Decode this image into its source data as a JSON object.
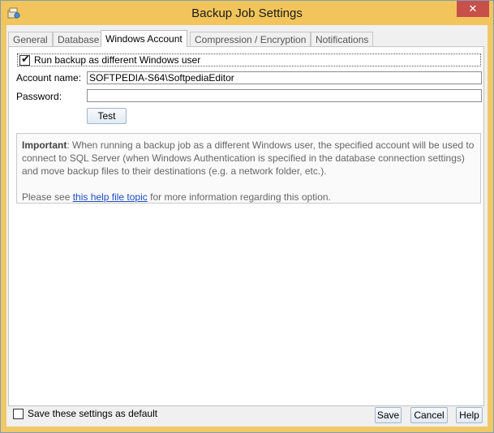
{
  "window": {
    "title": "Backup Job Settings",
    "close_glyph": "✕",
    "app_icon": "backup-app-icon"
  },
  "tabs": [
    {
      "label": "General",
      "active": false
    },
    {
      "label": "Database",
      "active": false
    },
    {
      "label": "Windows Account",
      "active": true
    },
    {
      "label": "Compression / Encryption",
      "active": false
    },
    {
      "label": "Notifications",
      "active": false
    }
  ],
  "form": {
    "run_as_checked": true,
    "run_as_label": "Run backup as different Windows user",
    "account_label": "Account name:",
    "account_value": "SOFTPEDIA-S64\\SoftpediaEditor",
    "password_label": "Password:",
    "password_value": "",
    "test_label": "Test"
  },
  "info": {
    "important": "Important",
    "body": ": When running a backup job as a different Windows user, the specified account will be used to connect to SQL Server (when Windows Authentication is specified in the database connection settings) and move backup files to their destinations (e.g. a network folder, etc.).",
    "see_prefix": "Please see ",
    "link_text": "this help file topic",
    "see_suffix": " for more information regarding this option."
  },
  "footer": {
    "default_checked": false,
    "default_label": "Save these settings as default",
    "save_label": "Save",
    "cancel_label": "Cancel",
    "help_label": "Help"
  },
  "colors": {
    "titlebar": "#f2c55c",
    "close": "#c7504b",
    "link": "#1b4bc3"
  }
}
